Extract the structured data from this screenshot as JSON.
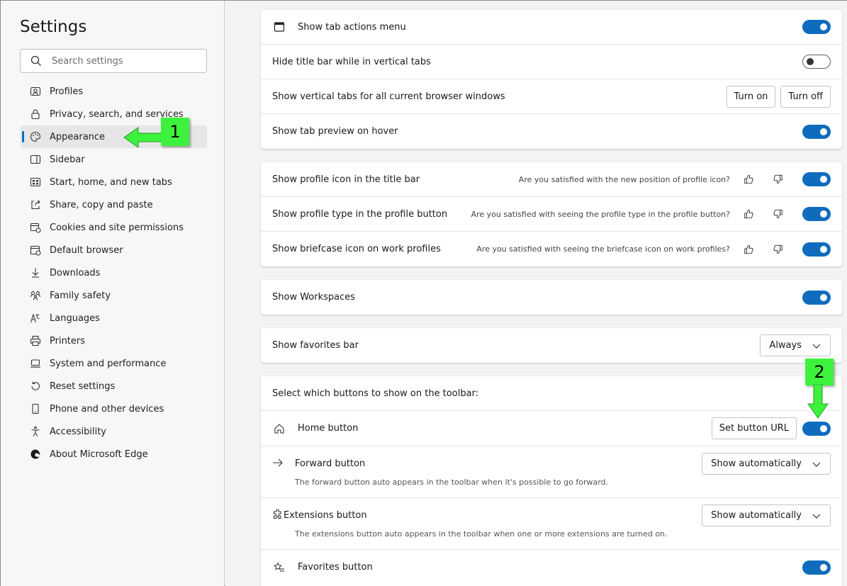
{
  "sidebar": {
    "title": "Settings",
    "search_placeholder": "Search settings",
    "items": [
      {
        "label": "Profiles",
        "icon": "profile-icon"
      },
      {
        "label": "Privacy, search, and services",
        "icon": "lock-icon"
      },
      {
        "label": "Appearance",
        "icon": "palette-icon"
      },
      {
        "label": "Sidebar",
        "icon": "sidebar-icon"
      },
      {
        "label": "Start, home, and new tabs",
        "icon": "home-tabs-icon"
      },
      {
        "label": "Share, copy and paste",
        "icon": "share-icon"
      },
      {
        "label": "Cookies and site permissions",
        "icon": "cookies-icon"
      },
      {
        "label": "Default browser",
        "icon": "browser-icon"
      },
      {
        "label": "Downloads",
        "icon": "download-icon"
      },
      {
        "label": "Family safety",
        "icon": "family-icon"
      },
      {
        "label": "Languages",
        "icon": "languages-icon"
      },
      {
        "label": "Printers",
        "icon": "printer-icon"
      },
      {
        "label": "System and performance",
        "icon": "laptop-icon"
      },
      {
        "label": "Reset settings",
        "icon": "reset-icon"
      },
      {
        "label": "Phone and other devices",
        "icon": "phone-icon"
      },
      {
        "label": "Accessibility",
        "icon": "accessibility-icon"
      },
      {
        "label": "About Microsoft Edge",
        "icon": "edge-icon"
      }
    ]
  },
  "tabs_card": {
    "tab_actions": "Show tab actions menu",
    "hide_title_bar": "Hide title bar while in vertical tabs",
    "vertical_tabs_all": "Show vertical tabs for all current browser windows",
    "turn_on": "Turn on",
    "turn_off": "Turn off",
    "tab_preview": "Show tab preview on hover"
  },
  "profile_card": {
    "rows": [
      {
        "label": "Show profile icon in the title bar",
        "feedback": "Are you satisfied with the new position of profile icon?"
      },
      {
        "label": "Show profile type in the profile button",
        "feedback": "Are you satisfied with seeing the profile type in the profile button?"
      },
      {
        "label": "Show briefcase icon on work profiles",
        "feedback": "Are you satisfied with seeing the briefcase icon on work profiles?"
      }
    ]
  },
  "workspaces": {
    "label": "Show Workspaces"
  },
  "favorites_bar": {
    "label": "Show favorites bar",
    "value": "Always"
  },
  "toolbar_card": {
    "heading": "Select which buttons to show on the toolbar:",
    "home": {
      "label": "Home button",
      "set_url": "Set button URL"
    },
    "forward": {
      "label": "Forward button",
      "value": "Show automatically",
      "desc": "The forward button auto appears in the toolbar when it's possible to go forward."
    },
    "extensions": {
      "label": "Extensions button",
      "value": "Show automatically",
      "desc": "The extensions button auto appears in the toolbar when one or more extensions are turned on."
    },
    "favorites": {
      "label": "Favorites button"
    }
  },
  "annotations": {
    "step1": "1",
    "step2": "2"
  },
  "colors": {
    "accent": "#0f6cbd",
    "annotation": "#3df23d"
  }
}
